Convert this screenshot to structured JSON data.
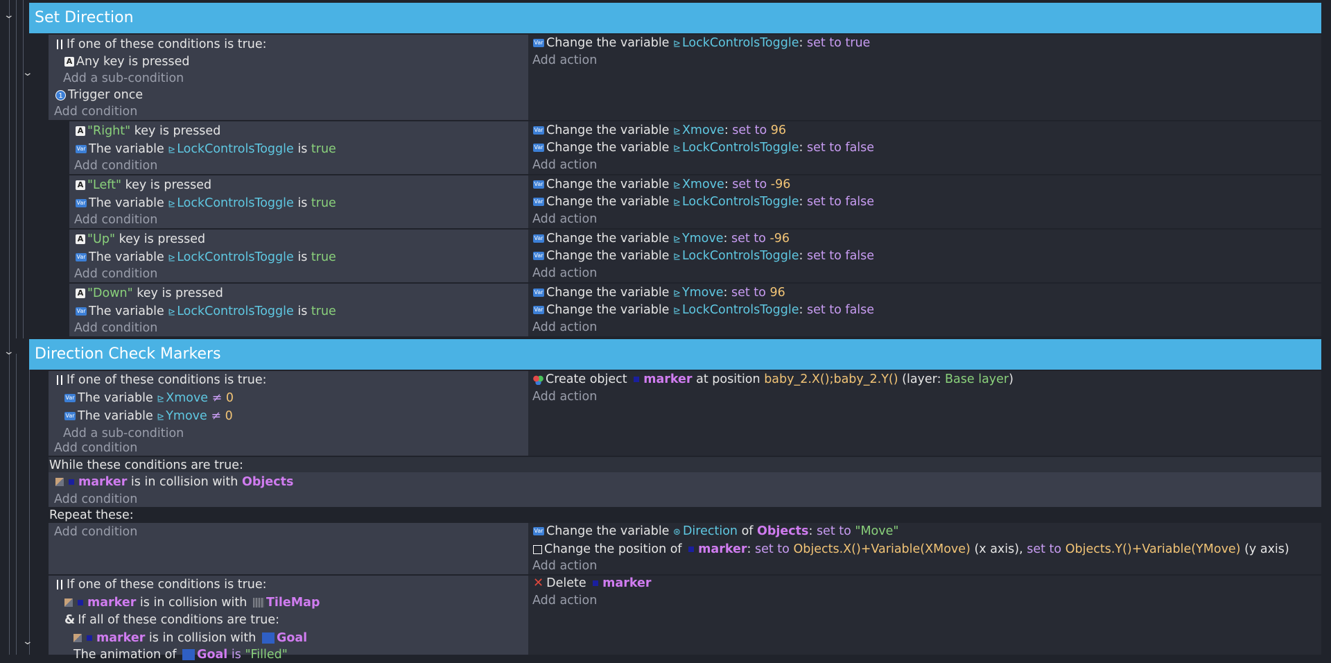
{
  "groups": [
    {
      "title": "Set Direction"
    },
    {
      "title": "Direction Check Markers"
    }
  ],
  "ui": {
    "add_condition": "Add condition",
    "add_action": "Add action",
    "add_sub_condition": "Add a sub-condition",
    "or_header": "If one of these conditions is true:",
    "and_header": "If all of these conditions are true:",
    "while_header": "While these conditions are true:",
    "repeat_header": "Repeat these:"
  },
  "words": {
    "any_key": "Any key is pressed",
    "trigger_once": "Trigger once",
    "key_is_pressed": "key is pressed",
    "the_variable": "The variable",
    "is": "is",
    "true": "true",
    "change_variable": "Change the variable",
    "set_to": "set to",
    "set_to_true": "set to true",
    "set_to_false": "set to false",
    "ne": "≠",
    "zero": "0",
    "create_object": "Create object",
    "at_position": "at position",
    "layer_open": "(layer:",
    "layer_close": ")",
    "base_layer": "Base layer",
    "position_expr": "baby_2.X();baby_2.Y()",
    "is_in_collision_with": "is in collision with",
    "of": "of",
    "change_position_of": "Change the position of",
    "x_expr": "Objects.X()+Variable(XMove)",
    "y_expr": "Objects.Y()+Variable(YMove)",
    "x_axis": "(x axis),",
    "y_axis": "(y axis)",
    "delete": "Delete",
    "animation_of": "The animation of",
    "filled": "\"Filled\""
  },
  "vars": {
    "lock": "LockControlsToggle",
    "xmove": "Xmove",
    "ymove": "Ymove",
    "direction": "Direction"
  },
  "values": {
    "pos96": "96",
    "neg96": "-96",
    "move": "\"Move\""
  },
  "keys": {
    "right": "\"Right\"",
    "left": "\"Left\"",
    "up": "\"Up\"",
    "down": "\"Down\""
  },
  "objects": {
    "marker": "marker",
    "objects": "Objects",
    "tilemap": "TileMap",
    "goal": "Goal"
  },
  "icons": {
    "key": "keyboard-key-icon",
    "variable": "variable-icon",
    "trigger_once": "trigger-once-icon",
    "or": "or-condition-icon",
    "collision": "collision-icon",
    "create": "create-object-icon",
    "position": "position-icon",
    "delete": "delete-icon",
    "chevron": "chevron-down-icon"
  },
  "colors": {
    "group_header": "#4ab2e4",
    "string": "#8ad17b",
    "variable": "#5fc8e2",
    "operator": "#c89cf2",
    "number": "#f2c476",
    "object": "#d07cf0"
  }
}
